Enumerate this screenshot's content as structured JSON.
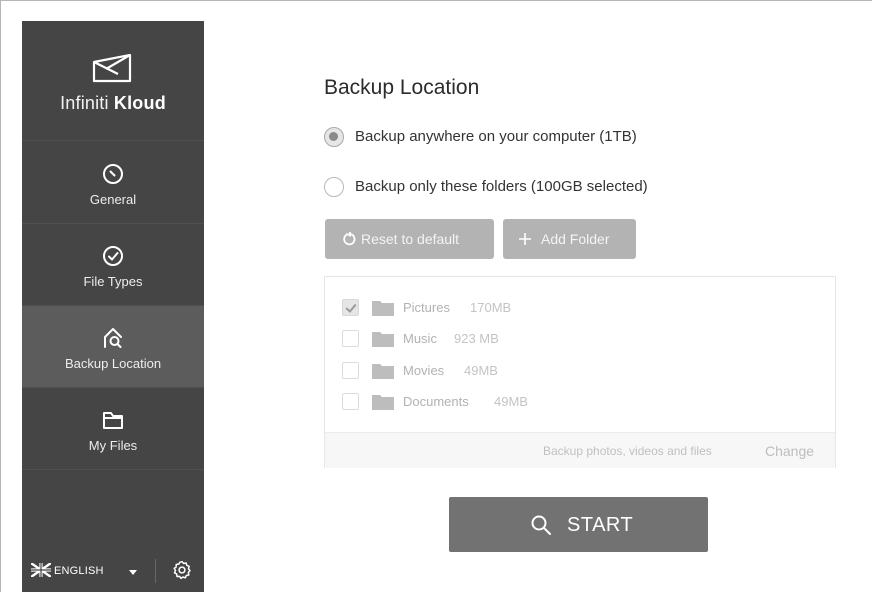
{
  "app": {
    "logo_light": "Infiniti",
    "logo_bold": "Kloud"
  },
  "sidebar": {
    "items": [
      {
        "label": "General",
        "icon": "dial-icon",
        "active": false
      },
      {
        "label": "File Types",
        "icon": "check-circle-icon",
        "active": false
      },
      {
        "label": "Backup Location",
        "icon": "home-search-icon",
        "active": true
      },
      {
        "label": "My Files",
        "icon": "folder-icon",
        "active": false
      }
    ],
    "language": "ENGLISH",
    "flag_icon": "uk-flag-icon",
    "settings_icon": "gear-icon"
  },
  "main": {
    "title": "Backup Location",
    "options": [
      {
        "label": "Backup anywhere on your computer (1TB)",
        "selected": true
      },
      {
        "label": "Backup only these folders (100GB selected)",
        "selected": false
      }
    ],
    "reset_label": "Reset to default",
    "add_folder_label": "Add Folder",
    "folders": [
      {
        "name": "Pictures",
        "size": "170MB",
        "checked": true
      },
      {
        "name": "Music",
        "size": "923 MB",
        "checked": false
      },
      {
        "name": "Movies",
        "size": "49MB",
        "checked": false
      },
      {
        "name": "Documents",
        "size": "49MB",
        "checked": false
      }
    ],
    "footer_text": "Backup photos, videos and files",
    "change_label": "Change",
    "start_label": "START"
  },
  "colors": {
    "sidebar_bg": "#454545",
    "sidebar_active": "#5c5c5c",
    "start_button": "#727272",
    "secondary_button": "#b3b3b3"
  }
}
